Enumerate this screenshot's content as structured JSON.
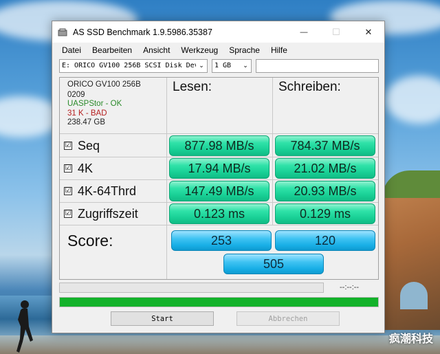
{
  "window": {
    "title": "AS SSD Benchmark 1.9.5986.35387",
    "controls": {
      "minimize": "—",
      "maximize": "☐",
      "close": "✕"
    }
  },
  "menu": [
    "Datei",
    "Bearbeiten",
    "Ansicht",
    "Werkzeug",
    "Sprache",
    "Hilfe"
  ],
  "toolbar": {
    "drive_select": "E: ORICO GV100 256B SCSI Disk Dev",
    "size_select": "1 GB",
    "input_value": ""
  },
  "drive_info": {
    "name": "ORICO GV100 256B",
    "firmware": "0209",
    "driver_status": "UASPStor - OK",
    "alignment_status": "31 K - BAD",
    "capacity": "238.47 GB"
  },
  "columns": {
    "read": "Lesen:",
    "write": "Schreiben:"
  },
  "tests": [
    {
      "label": "Seq",
      "read": "877.98 MB/s",
      "write": "784.37 MB/s",
      "checked": "☑"
    },
    {
      "label": "4K",
      "read": "17.94 MB/s",
      "write": "21.02 MB/s",
      "checked": "☑"
    },
    {
      "label": "4K-64Thrd",
      "read": "147.49 MB/s",
      "write": "20.93 MB/s",
      "checked": "☑"
    },
    {
      "label": "Zugriffszeit",
      "read": "0.123 ms",
      "write": "0.129 ms",
      "checked": "☑"
    }
  ],
  "score": {
    "label": "Score:",
    "read": "253",
    "write": "120",
    "total": "505"
  },
  "progress": {
    "time": "--:--:--",
    "test_progress": 0,
    "total_progress": 1.0
  },
  "buttons": {
    "start": "Start",
    "abort": "Abbrechen"
  },
  "colors": {
    "value_green": "#19d096",
    "score_blue": "#18aee6",
    "progress_green": "#13b22a"
  },
  "watermark": "疯潮科技"
}
